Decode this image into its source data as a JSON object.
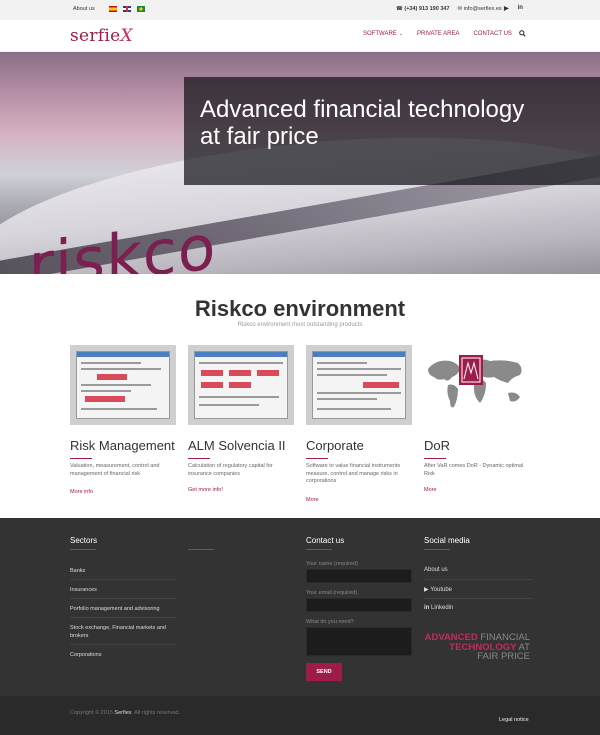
{
  "topbar": {
    "about": "About us",
    "phone": "(+34) 913 190 347",
    "email": "info@serfiex.es",
    "youtube_glyph": "▶",
    "linkedin_glyph": "in",
    "flags": [
      "es-flag-icon",
      "en-flag-icon",
      "br-flag-icon"
    ]
  },
  "header": {
    "logo_main": "serfie",
    "logo_x": "X",
    "nav": {
      "software": "SOFTWARE",
      "private": "PRIVATE AREA",
      "contact": "CONTACT US"
    }
  },
  "hero": {
    "headline_line1": "Advanced financial technology",
    "headline_line2": "at fair price",
    "train_text": "riskco"
  },
  "environment": {
    "title": "Riskco environment",
    "subtitle": "Riskco environment most outstanding products",
    "products": [
      {
        "name": "Risk Management",
        "desc": "Valuation, measurement, control and management of financial risk",
        "link": "More info"
      },
      {
        "name": "ALM Solvencia II",
        "desc": "Calculation of regulatory capital for insurance companies",
        "link": "Get more info!"
      },
      {
        "name": "Corporate",
        "desc": "Software to value financial instruments measure, control and manage risks in corporations",
        "link": "More"
      },
      {
        "name": "DoR",
        "desc": "After VaR comes DoR - Dynamic optimal Risk",
        "link": "More"
      }
    ]
  },
  "footer": {
    "sectors_title": "Sectors",
    "sectors": [
      "Banks",
      "Insurances",
      "Porfolio management and advisoring",
      "Stock exchange, Financial markets and brokers",
      "Corporations"
    ],
    "contact_title": "Contact us",
    "name_label": "Your name (required)",
    "email_label": "Your email (required)",
    "need_label": "What do you need?",
    "send": "SEND",
    "social_title": "Social media",
    "social": [
      "About us",
      "Youtube",
      "Linkedin"
    ],
    "tagline": {
      "advanced": "ADVANCED",
      "financial": " FINANCIAL",
      "technology": "TECHNOLOGY",
      "at": " AT",
      "fair_price": "FAIR PRICE"
    }
  },
  "bottom": {
    "copyright_pre": "Copyright © 2015",
    "brand": "Serfiex",
    "copyright_post": ". All rights reserved.",
    "legal": "Legal notice"
  },
  "colors": {
    "accent": "#9e1c4a",
    "footer_bg": "#333333",
    "bottom_bg": "#2a2a2a"
  }
}
